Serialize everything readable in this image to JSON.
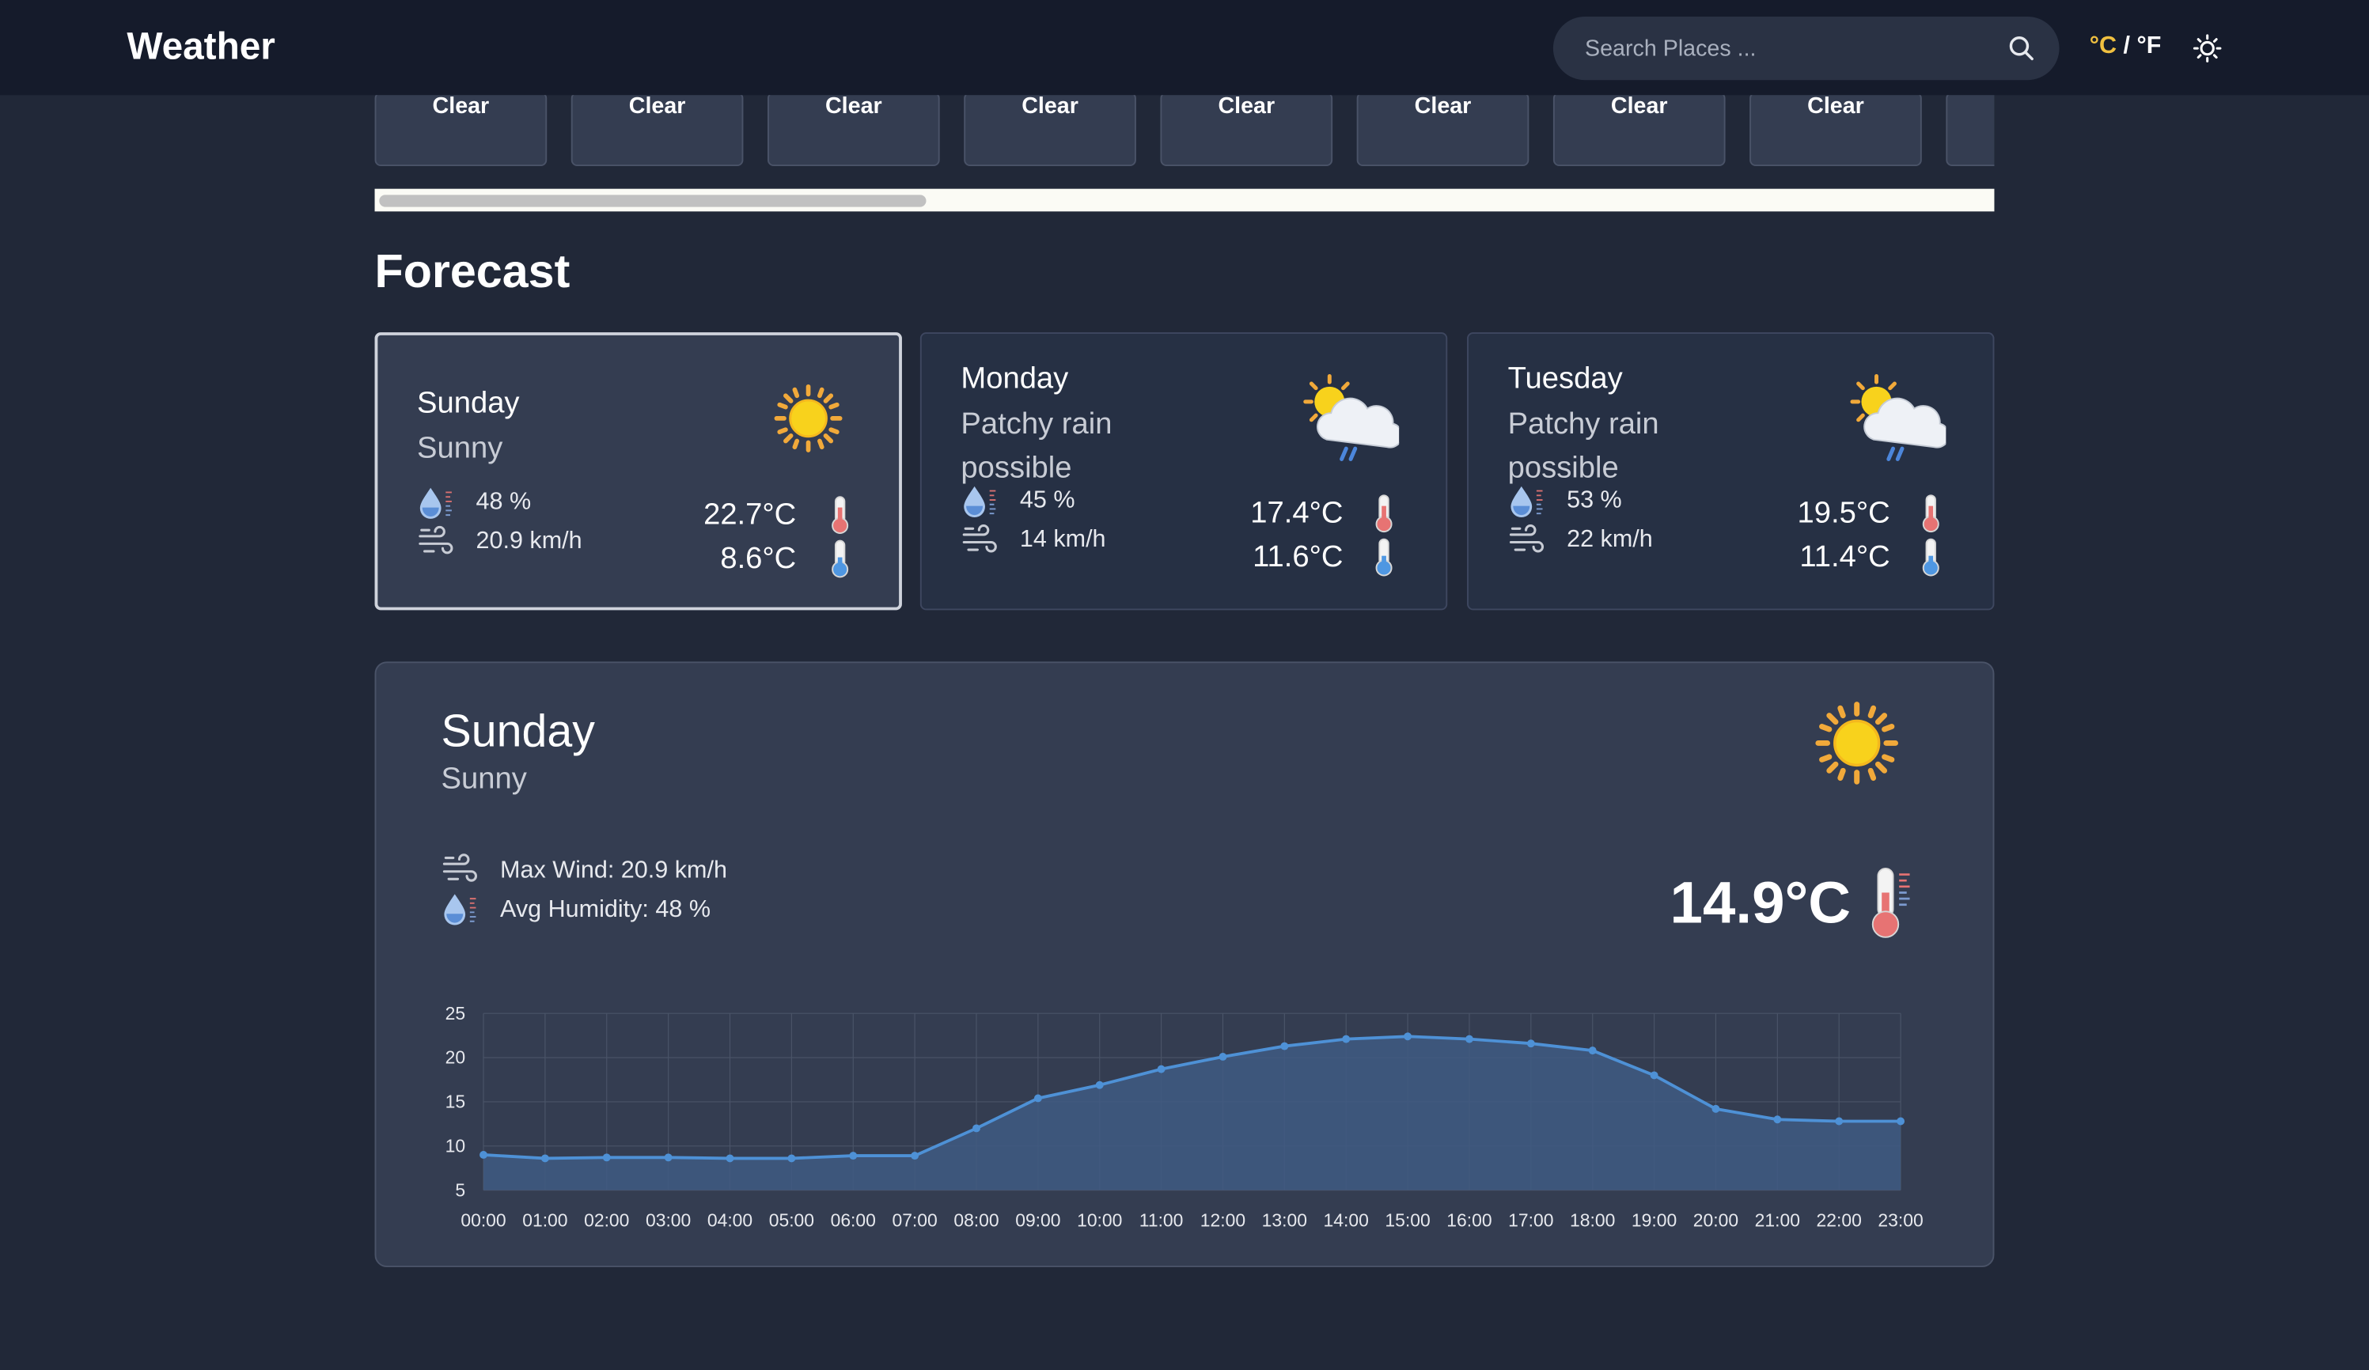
{
  "header": {
    "title": "Weather",
    "search_placeholder": "Search Places ...",
    "unit_c": "°C",
    "unit_sep": " / ",
    "unit_f": "°F"
  },
  "hourly": {
    "labels": [
      "Clear",
      "Clear",
      "Clear",
      "Clear",
      "Clear",
      "Clear",
      "Clear",
      "Clear",
      ""
    ]
  },
  "forecast": {
    "title": "Forecast",
    "days": [
      {
        "day": "Sunday",
        "condition": "Sunny",
        "humidity": "48 %",
        "wind": "20.9 km/h",
        "max": "22.7°C",
        "min": "8.6°C",
        "icon": "sun-icon"
      },
      {
        "day": "Monday",
        "condition": "Patchy rain possible",
        "humidity": "45 %",
        "wind": "14 km/h",
        "max": "17.4°C",
        "min": "11.6°C",
        "icon": "patchy-rain-icon"
      },
      {
        "day": "Tuesday",
        "condition": "Patchy rain possible",
        "humidity": "53 %",
        "wind": "22 km/h",
        "max": "19.5°C",
        "min": "11.4°C",
        "icon": "patchy-rain-icon"
      }
    ]
  },
  "detail": {
    "day": "Sunday",
    "condition": "Sunny",
    "max_wind": "Max Wind: 20.9 km/h",
    "avg_humidity": "Avg Humidity: 48 %",
    "temp": "14.9°C"
  },
  "chart_data": {
    "type": "area",
    "x": [
      "00:00",
      "01:00",
      "02:00",
      "03:00",
      "04:00",
      "05:00",
      "06:00",
      "07:00",
      "08:00",
      "09:00",
      "10:00",
      "11:00",
      "12:00",
      "13:00",
      "14:00",
      "15:00",
      "16:00",
      "17:00",
      "18:00",
      "19:00",
      "20:00",
      "21:00",
      "22:00",
      "23:00"
    ],
    "values": [
      9.0,
      8.6,
      8.7,
      8.7,
      8.6,
      8.6,
      8.9,
      8.9,
      12.0,
      15.4,
      16.9,
      18.7,
      20.1,
      21.3,
      22.1,
      22.4,
      22.1,
      21.6,
      20.8,
      18.0,
      14.2,
      13.0,
      12.8,
      12.8
    ],
    "yticks": [
      "25",
      "20",
      "15",
      "10",
      "5"
    ],
    "ylim": [
      5,
      25
    ],
    "grid": true,
    "colors": {
      "line": "#4e91d6",
      "fill": "#3f5a82"
    }
  }
}
